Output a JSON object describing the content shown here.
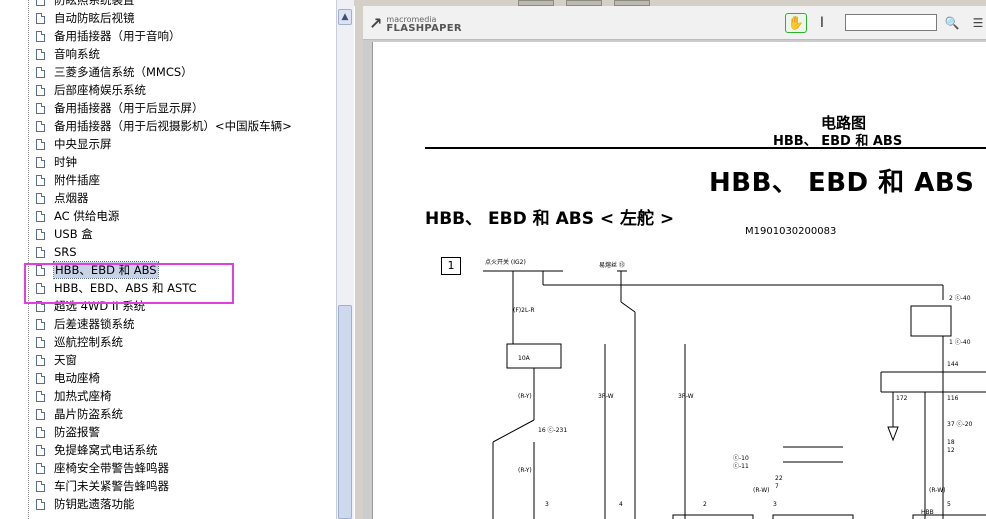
{
  "tree": {
    "header_partial": "ꞏ▬▬▬▬▬▬▬▬▬▬",
    "items": [
      {
        "label": "防眩照系统装置"
      },
      {
        "label": "自动防眩后视镜"
      },
      {
        "label": "备用插接器（用于音响）"
      },
      {
        "label": "音响系统"
      },
      {
        "label": "三菱多通信系统（MMCS）"
      },
      {
        "label": "后部座椅娱乐系统"
      },
      {
        "label": "备用插接器（用于后显示屏）"
      },
      {
        "label": "备用插接器（用于后视摄影机）<中国版车辆>"
      },
      {
        "label": "中央显示屏"
      },
      {
        "label": "时钟"
      },
      {
        "label": "附件插座"
      },
      {
        "label": "点烟器"
      },
      {
        "label": "AC 供给电源"
      },
      {
        "label": "USB 盒"
      },
      {
        "label": "SRS"
      },
      {
        "label": "HBB、EBD 和 ABS",
        "selected": true
      },
      {
        "label": "HBB、EBD、ABS 和 ASTC"
      },
      {
        "label": "超选 4WD II 系统"
      },
      {
        "label": "后差速器锁系统"
      },
      {
        "label": "巡航控制系统"
      },
      {
        "label": "天窗"
      },
      {
        "label": "电动座椅"
      },
      {
        "label": "加热式座椅"
      },
      {
        "label": "晶片防盗系统"
      },
      {
        "label": "防盗报警"
      },
      {
        "label": "免提蜂窝式电话系统"
      },
      {
        "label": "座椅安全带警告蜂鸣器"
      },
      {
        "label": "车门未关紧警告蜂鸣器"
      },
      {
        "label": "防钥匙遗落功能"
      }
    ],
    "highlight_color": "#e040e0"
  },
  "viewer": {
    "logo_top": "macromedia",
    "logo_bottom": "FLASHPAPER",
    "logo_mark": "↗",
    "hand_tool": "✋",
    "text_tool": "I",
    "search_value": "",
    "search_btn": "🔍",
    "menu_btn": "☰",
    "accent": "#2fb02f"
  },
  "page": {
    "header_title": "电路图",
    "header_sub": "HBB、 EBD 和 ABS",
    "big_title": "HBB、 EBD 和 ABS",
    "section_title": "HBB、 EBD 和 ABS < 左舵 >",
    "code": "M1901030200083",
    "box_label": "1",
    "wire_labels": {
      "ig2": "点火开关 (IG2)",
      "relay": "易熔丝 ⑬",
      "f2l": "(F)2L-R",
      "r_y": "(R-Y)",
      "s3r": "3R-W",
      "fuse10": "10A",
      "c231": "16 ⓒ-231",
      "n40": "2 ⓒ-40",
      "n40b": "1 ⓒ-40",
      "n144": "144",
      "n172": "172",
      "n116": "116",
      "n37": "37 ⓒ-20",
      "n18": "18",
      "n12": "12",
      "c11": "ⓒ-11",
      "c10": "ⓒ-10",
      "n22": "22",
      "n7": "7",
      "pin3a": "3",
      "pin4": "4",
      "pin2": "2",
      "pin3b": "3",
      "pin5": "5",
      "rw": "(R-W)",
      "hbb": "HBB"
    }
  }
}
